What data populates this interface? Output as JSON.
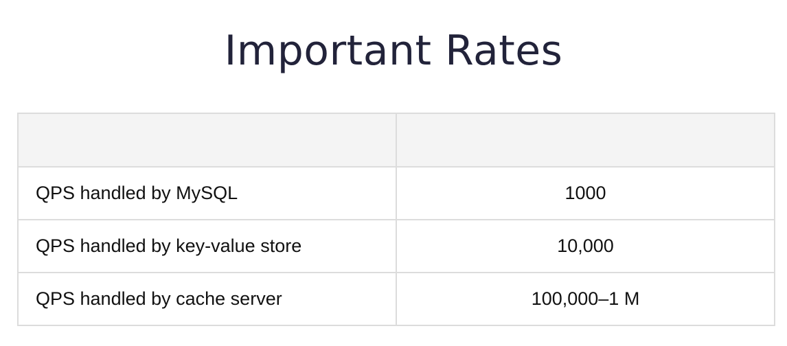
{
  "page": {
    "title": "Important Rates"
  },
  "table": {
    "headers": [
      "",
      ""
    ],
    "rows": [
      {
        "metric": "QPS handled by MySQL",
        "value": "1000"
      },
      {
        "metric": "QPS handled by key-value store",
        "value": "10,000"
      },
      {
        "metric": "QPS handled by cache server",
        "value": "100,000–1 M"
      }
    ]
  }
}
